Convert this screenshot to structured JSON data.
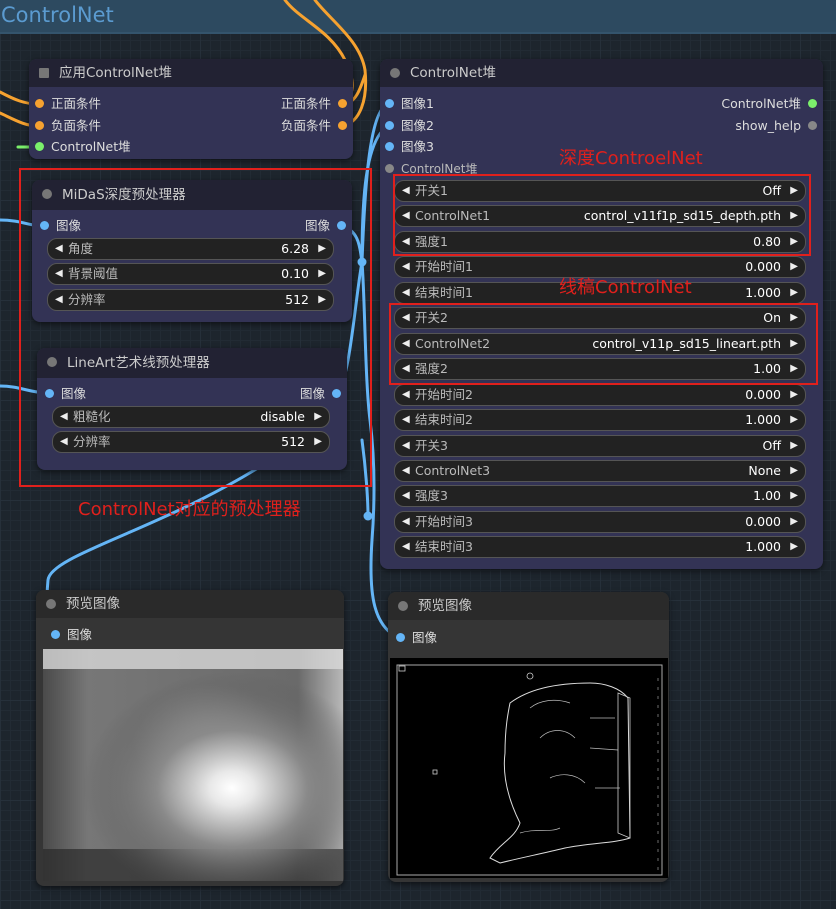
{
  "group_title": "ControlNet",
  "apply_node": {
    "title": "应用ControlNet堆",
    "inputs": [
      "正面条件",
      "负面条件",
      "ControlNet堆"
    ],
    "outputs": [
      "正面条件",
      "负面条件"
    ]
  },
  "stack_node": {
    "title": "ControlNet堆",
    "inputs": [
      "图像1",
      "图像2",
      "图像3",
      "ControlNet堆"
    ],
    "outputs": [
      "ControlNet堆",
      "show_help"
    ],
    "widgets": [
      {
        "label": "开关1",
        "value": "Off"
      },
      {
        "label": "ControlNet1",
        "value": "control_v11f1p_sd15_depth.pth"
      },
      {
        "label": "强度1",
        "value": "0.80"
      },
      {
        "label": "开始时间1",
        "value": "0.000"
      },
      {
        "label": "结束时间1",
        "value": "1.000"
      },
      {
        "label": "开关2",
        "value": "On"
      },
      {
        "label": "ControlNet2",
        "value": "control_v11p_sd15_lineart.pth"
      },
      {
        "label": "强度2",
        "value": "1.00"
      },
      {
        "label": "开始时间2",
        "value": "0.000"
      },
      {
        "label": "结束时间2",
        "value": "1.000"
      },
      {
        "label": "开关3",
        "value": "Off"
      },
      {
        "label": "ControlNet3",
        "value": "None"
      },
      {
        "label": "强度3",
        "value": "1.00"
      },
      {
        "label": "开始时间3",
        "value": "0.000"
      },
      {
        "label": "结束时间3",
        "value": "1.000"
      }
    ]
  },
  "midas_node": {
    "title": "MiDaS深度预处理器",
    "input": "图像",
    "output": "图像",
    "widgets": [
      {
        "label": "角度",
        "value": "6.28"
      },
      {
        "label": "背景阈值",
        "value": "0.10"
      },
      {
        "label": "分辨率",
        "value": "512"
      }
    ]
  },
  "lineart_node": {
    "title": "LineArt艺术线预处理器",
    "input": "图像",
    "output": "图像",
    "widgets": [
      {
        "label": "粗糙化",
        "value": "disable"
      },
      {
        "label": "分辨率",
        "value": "512"
      }
    ]
  },
  "preview_left": {
    "title": "预览图像",
    "input": "图像"
  },
  "preview_right": {
    "title": "预览图像",
    "input": "图像"
  },
  "annotations": {
    "depth": "深度ControelNet",
    "lineart": "线稿ControlNet",
    "preproc": "ControlNet对应的预处理器"
  },
  "colors": {
    "annotation_red": "#e0201c",
    "wire_orange": "#f6a230",
    "wire_blue": "#64b5f6",
    "wire_green": "#7bf06b"
  }
}
